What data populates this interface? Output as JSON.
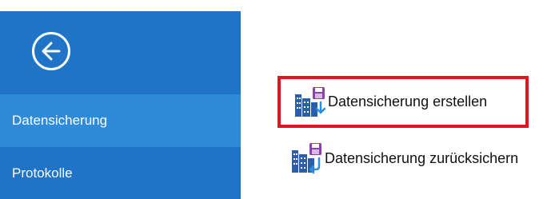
{
  "back_button": {
    "icon": "arrow-left-circle-icon"
  },
  "sidebar": {
    "background": "#1f74c8",
    "active_background": "#2f8bd9",
    "items": [
      {
        "label": "Datensicherung",
        "active": true
      },
      {
        "label": "Protokolle",
        "active": false
      }
    ]
  },
  "actions": [
    {
      "label": "Datensicherung erstellen",
      "icon": "database-save-icon",
      "highlighted": true,
      "highlight_color": "#e3141b"
    },
    {
      "label": "Datensicherung zurücksichern",
      "icon": "database-restore-icon",
      "highlighted": false
    }
  ]
}
